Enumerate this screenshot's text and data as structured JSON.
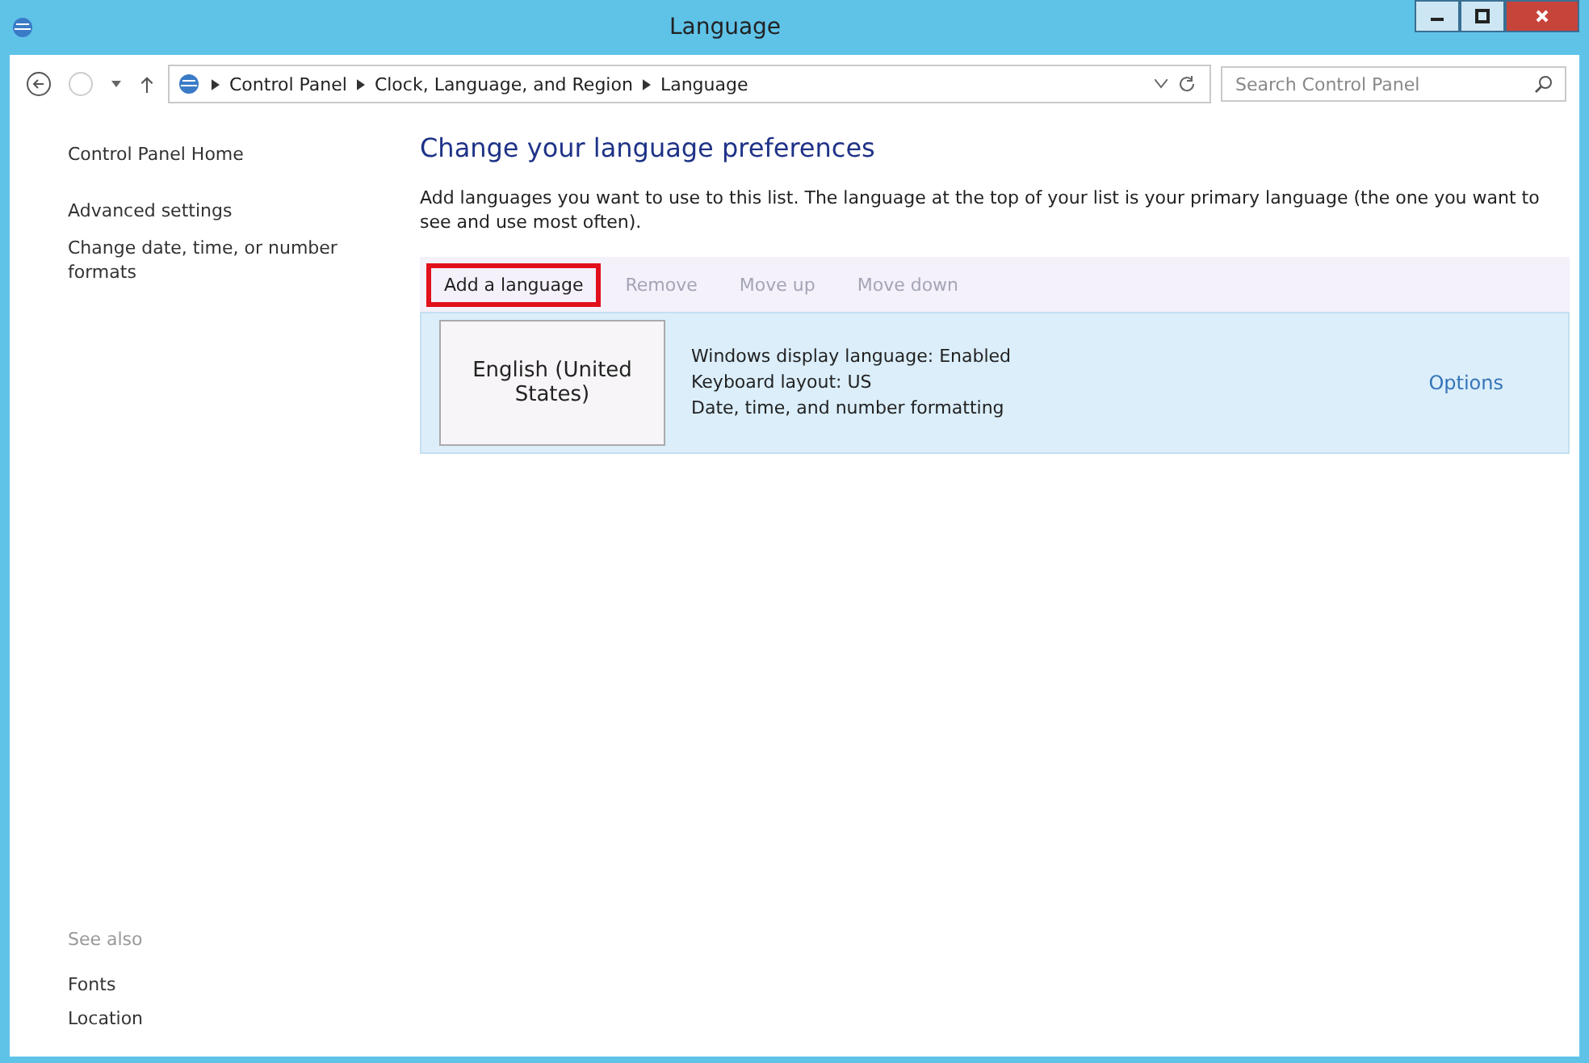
{
  "window": {
    "title": "Language"
  },
  "address_bar": {
    "breadcrumbs": [
      "Control Panel",
      "Clock, Language, and Region",
      "Language"
    ],
    "search_placeholder": "Search Control Panel"
  },
  "sidebar": {
    "links": [
      "Control Panel Home",
      "Advanced settings",
      "Change date, time, or number formats"
    ],
    "see_also_heading": "See also",
    "see_also_links": [
      "Fonts",
      "Location"
    ]
  },
  "main": {
    "heading": "Change your language preferences",
    "description": "Add languages you want to use to this list. The language at the top of your list is your primary language (the one you want to see and use most often).",
    "toolbar": [
      {
        "label": "Add a language",
        "disabled": false,
        "highlighted": true
      },
      {
        "label": "Remove",
        "disabled": true,
        "highlighted": false
      },
      {
        "label": "Move up",
        "disabled": true,
        "highlighted": false
      },
      {
        "label": "Move down",
        "disabled": true,
        "highlighted": false
      }
    ],
    "languages": [
      {
        "name": "English (United States)",
        "details": [
          "Windows display language: Enabled",
          "Keyboard layout: US",
          "Date, time, and number formatting"
        ],
        "options": "Options",
        "selected": true
      }
    ]
  }
}
